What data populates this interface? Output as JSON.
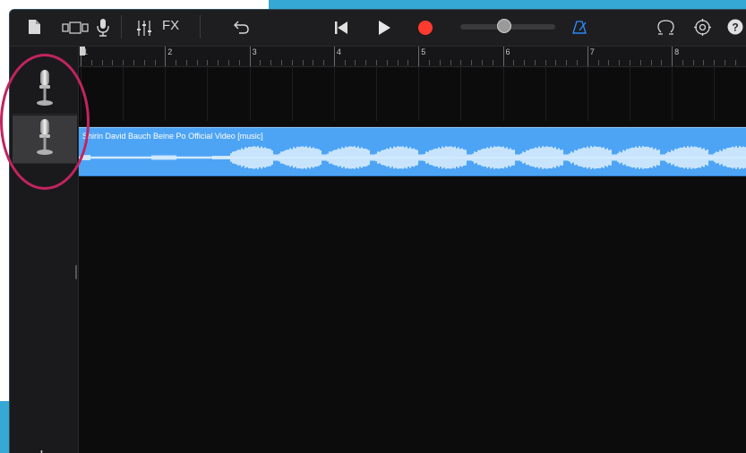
{
  "toolbar": {
    "fx_label": "FX",
    "icons": {
      "document": "document-icon",
      "view_toggle": "view-toggle-icon",
      "microphone": "microphone-icon",
      "mixer": "mixer-icon",
      "undo": "undo-icon",
      "go_to_start": "go-to-start-icon",
      "play": "play-icon",
      "record": "record-icon",
      "metronome": "metronome-icon",
      "loop_browser": "loop-browser-icon",
      "settings": "settings-icon",
      "help": "help-icon"
    },
    "master_volume": 0.5,
    "colors": {
      "record": "#ff3b30",
      "metronome_active": "#2f8cff"
    }
  },
  "ruler": {
    "bars": [
      "1",
      "2",
      "3",
      "4",
      "5",
      "6",
      "7",
      "8"
    ]
  },
  "tracks": [
    {
      "instrument_icon": "microphone-icon",
      "selected": false
    },
    {
      "instrument_icon": "microphone-icon",
      "selected": true
    }
  ],
  "region": {
    "title": "Shirin David Bauch Beine Po Official Video [music]",
    "color": "#4da4f5"
  },
  "add_track_label": "+",
  "annotation_color": "#c2245e"
}
